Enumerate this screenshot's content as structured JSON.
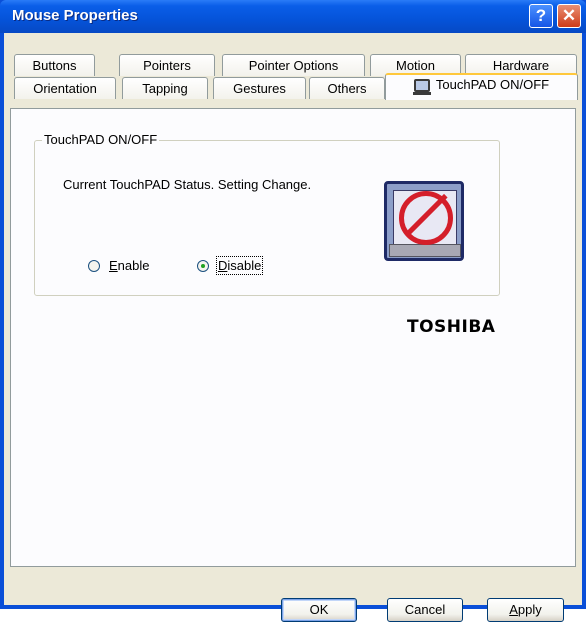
{
  "window": {
    "title": "Mouse Properties",
    "help_label": "?",
    "close_label": "✕",
    "colors": {
      "titlebar": "#0553d9",
      "client": "#ece9d8",
      "active_tab_highlight": "#ffc83c"
    }
  },
  "tabs_row1": [
    {
      "label": "Buttons"
    },
    {
      "label": "Pointers"
    },
    {
      "label": "Pointer Options"
    },
    {
      "label": "Motion"
    },
    {
      "label": "Hardware"
    }
  ],
  "tabs_row2": [
    {
      "label": "Orientation"
    },
    {
      "label": "Tapping"
    },
    {
      "label": "Gestures"
    },
    {
      "label": "Others"
    },
    {
      "label": "TouchPAD ON/OFF",
      "icon": "touchpad-icon",
      "selected": true
    }
  ],
  "group": {
    "legend": "TouchPAD ON/OFF",
    "status_text": "Current TouchPAD Status. Setting Change.",
    "options": [
      {
        "label": "Enable",
        "accesskey": "E",
        "checked": false
      },
      {
        "label": "Disable",
        "accesskey": "D",
        "checked": true
      }
    ],
    "status_icon": "touchpad-disabled-icon"
  },
  "brand": "TOSHIBA",
  "buttons": {
    "ok": "OK",
    "cancel": "Cancel",
    "apply": "Apply"
  }
}
